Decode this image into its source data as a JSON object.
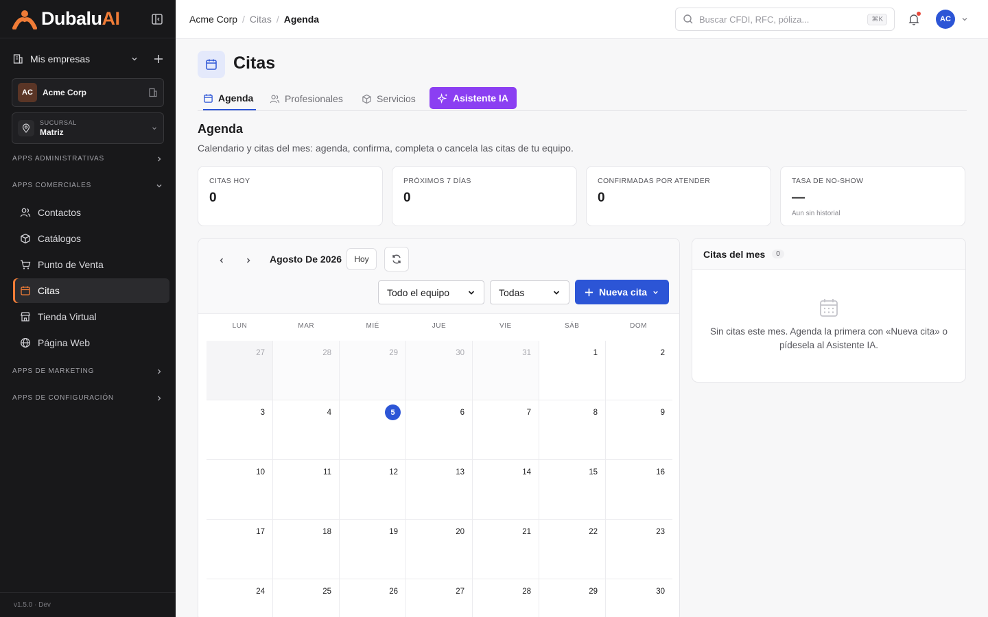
{
  "brand": {
    "name_main": "Dubalu",
    "name_accent": "AI"
  },
  "sidebar": {
    "mis_empresas": "Mis empresas",
    "company": {
      "initials": "AC",
      "name": "Acme Corp"
    },
    "branch": {
      "caption": "SUCURSAL",
      "value": "Matriz"
    },
    "groups": {
      "admin": "APPS ADMINISTRATIVAS",
      "comerciales": "APPS COMERCIALES",
      "marketing": "APPS DE MARKETING",
      "config": "APPS DE CONFIGURACIÓN"
    },
    "items": [
      {
        "label": "Contactos",
        "icon": "users-icon"
      },
      {
        "label": "Catálogos",
        "icon": "box-icon"
      },
      {
        "label": "Punto de Venta",
        "icon": "cart-icon"
      },
      {
        "label": "Citas",
        "icon": "calendar-icon",
        "active": true
      },
      {
        "label": "Tienda Virtual",
        "icon": "store-icon"
      },
      {
        "label": "Página Web",
        "icon": "globe-icon"
      }
    ],
    "version": "v1.5.0 · Dev"
  },
  "topbar": {
    "breadcrumb": [
      "Acme Corp",
      "Citas",
      "Agenda"
    ],
    "search_placeholder": "Buscar CFDI, RFC, póliza...",
    "search_shortcut": "⌘K",
    "user_initials": "AC"
  },
  "page": {
    "title": "Citas",
    "tabs": [
      {
        "label": "Agenda",
        "active": true
      },
      {
        "label": "Profesionales"
      },
      {
        "label": "Servicios"
      },
      {
        "label": "Asistente IA"
      }
    ],
    "section_title": "Agenda",
    "section_desc": "Calendario y citas del mes: agenda, confirma, completa o cancela las citas de tu equipo."
  },
  "kpis": [
    {
      "label": "CITAS HOY",
      "value": "0",
      "sub": ""
    },
    {
      "label": "PRÓXIMOS 7 DÍAS",
      "value": "0",
      "sub": ""
    },
    {
      "label": "CONFIRMADAS POR ATENDER",
      "value": "0",
      "sub": ""
    },
    {
      "label": "TASA DE NO-SHOW",
      "value": "—",
      "sub": "Aun sin historial"
    }
  ],
  "calendar": {
    "month_label": "Agosto De 2026",
    "today_button": "Hoy",
    "filter_team": "Todo el equipo",
    "filter_status": "Todas",
    "new_button": "Nueva cita",
    "weekdays": [
      "LUN",
      "MAR",
      "MIÉ",
      "JUE",
      "VIE",
      "SÁB",
      "DOM"
    ],
    "weeks": [
      [
        "27",
        "28",
        "29",
        "30",
        "31",
        "1",
        "2"
      ],
      [
        "3",
        "4",
        "5",
        "6",
        "7",
        "8",
        "9"
      ],
      [
        "10",
        "11",
        "12",
        "13",
        "14",
        "15",
        "16"
      ],
      [
        "17",
        "18",
        "19",
        "20",
        "21",
        "22",
        "23"
      ],
      [
        "24",
        "25",
        "26",
        "27",
        "28",
        "29",
        "30"
      ]
    ],
    "today": "5"
  },
  "side": {
    "title": "Citas del mes",
    "count": "0",
    "empty_msg": "Sin citas este mes. Agenda la primera con «Nueva cita» o pídesela al Asistente IA."
  },
  "colors": {
    "accent": "#2c55d6",
    "brand": "#f07c37",
    "ai": "#8b3ff2"
  }
}
